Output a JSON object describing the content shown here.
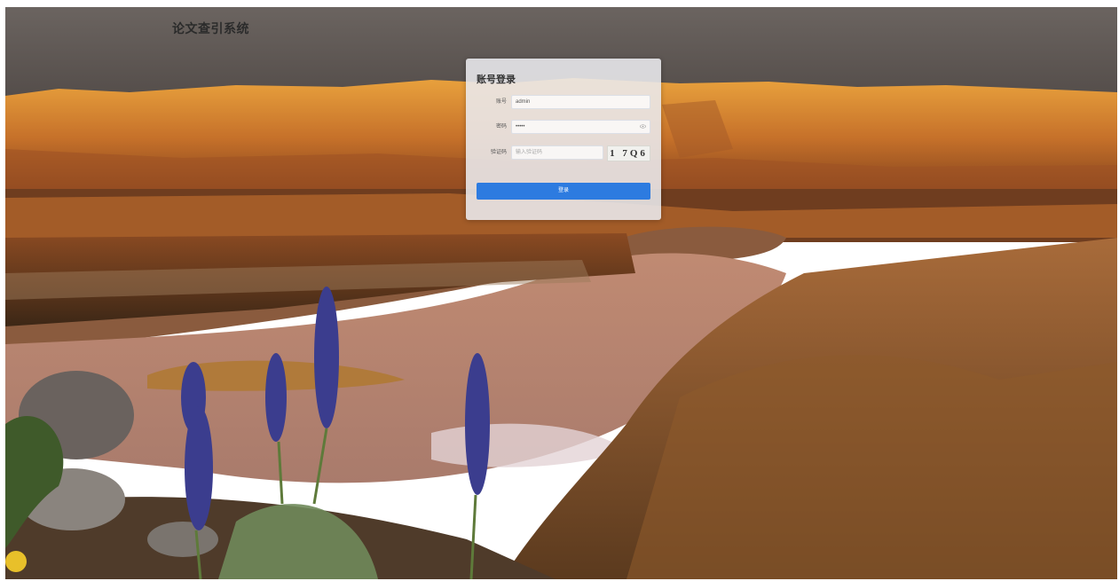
{
  "app": {
    "title": "论文查引系统"
  },
  "login": {
    "heading": "账号登录",
    "account": {
      "label": "账号",
      "value": "admin"
    },
    "password": {
      "label": "密码",
      "masked_value": "•••••",
      "toggle_icon": "eye-icon"
    },
    "captcha": {
      "label": "验证码",
      "placeholder": "输入验证码",
      "code": "1 7Q6"
    },
    "submit_label": "登录"
  },
  "colors": {
    "primary_button": "#2d7be0",
    "sky": "#5d5552",
    "cliff": "#d98a2f",
    "river": "#b58a76",
    "lupine": "#3a3a8c"
  }
}
